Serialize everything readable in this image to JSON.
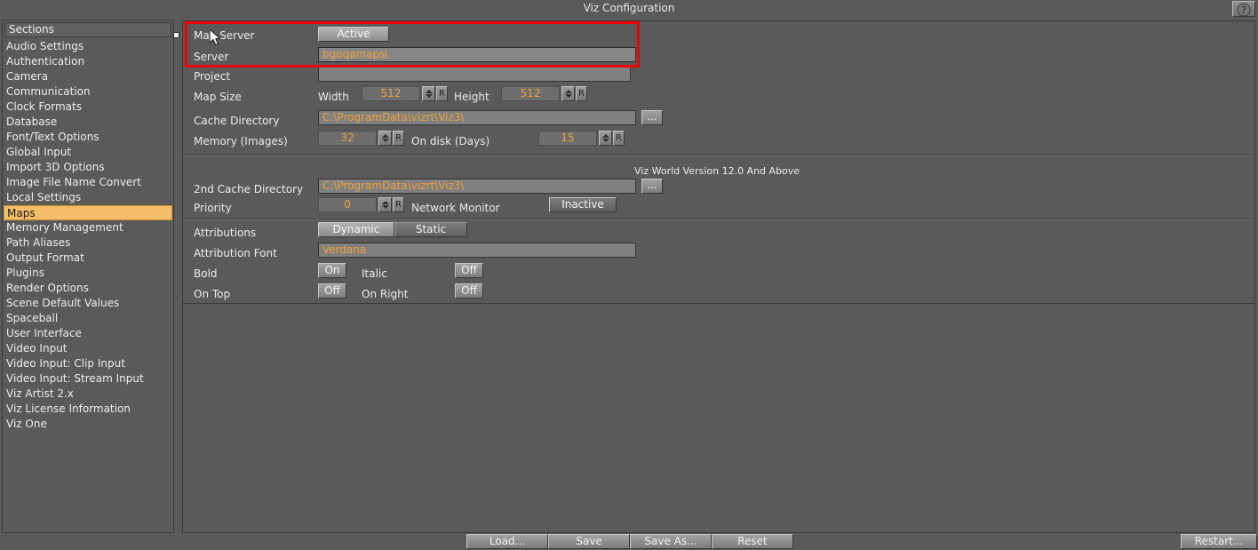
{
  "window": {
    "title": "Viz Configuration",
    "help_icon": "question-mark-icon"
  },
  "sidebar": {
    "header": "Sections",
    "selected": "Maps",
    "items": [
      {
        "label": "Audio Settings"
      },
      {
        "label": "Authentication"
      },
      {
        "label": "Camera"
      },
      {
        "label": "Communication"
      },
      {
        "label": "Clock Formats"
      },
      {
        "label": "Database"
      },
      {
        "label": "Font/Text Options"
      },
      {
        "label": "Global Input"
      },
      {
        "label": "Import 3D Options"
      },
      {
        "label": "Image File Name Convert"
      },
      {
        "label": "Local Settings"
      },
      {
        "label": "Maps"
      },
      {
        "label": "Memory Management"
      },
      {
        "label": "Path Aliases"
      },
      {
        "label": "Output Format"
      },
      {
        "label": "Plugins"
      },
      {
        "label": "Render Options"
      },
      {
        "label": "Scene Default Values"
      },
      {
        "label": "Spaceball"
      },
      {
        "label": "User Interface"
      },
      {
        "label": "Video Input"
      },
      {
        "label": "Video Input: Clip Input"
      },
      {
        "label": "Video Input: Stream Input"
      },
      {
        "label": "Viz Artist 2.x"
      },
      {
        "label": "Viz License Information"
      },
      {
        "label": "Viz One"
      }
    ]
  },
  "maps": {
    "map_server": {
      "label": "Map Server",
      "state": "Active"
    },
    "server": {
      "label": "Server",
      "value": "bgoqamaps"
    },
    "project": {
      "label": "Project",
      "value": ""
    },
    "map_size": {
      "label": "Map Size",
      "width_label": "Width",
      "width_value": "512",
      "width_reset": "R",
      "height_label": "Height",
      "height_value": "512",
      "height_reset": "R"
    },
    "cache_directory": {
      "label": "Cache Directory",
      "value": "C:\\ProgramData\\vizrt\\Viz3\\",
      "browse": "..."
    },
    "memory": {
      "label": "Memory (Images)",
      "value": "32",
      "reset": "R",
      "ondisk_label": "On disk (Days)",
      "ondisk_value": "15",
      "ondisk_reset": "R"
    },
    "vizworld": {
      "header": "Viz World Version 12.0 And Above",
      "second_cache_label": "2nd Cache Directory",
      "second_cache_value": "C:\\ProgramData\\vizrt\\Viz3\\",
      "second_cache_browse": "...",
      "priority_label": "Priority",
      "priority_value": "0",
      "priority_reset": "R",
      "network_monitor_label": "Network Monitor",
      "network_monitor_state": "Inactive"
    },
    "attributions": {
      "label": "Attributions",
      "dynamic": "Dynamic",
      "static": "Static",
      "font_label": "Attribution Font",
      "font_value": "Verdana",
      "bold_label": "Bold",
      "bold_state": "On",
      "italic_label": "Italic",
      "italic_state": "Off",
      "ontop_label": "On Top",
      "ontop_state": "Off",
      "onright_label": "On Right",
      "onright_state": "Off"
    }
  },
  "footer": {
    "load": "Load...",
    "save": "Save",
    "save_as": "Save As...",
    "reset": "Reset",
    "restart": "Restart..."
  },
  "colors": {
    "accent_value": "#f0a23c",
    "selection": "#f5be6b",
    "highlight_box": "#f20000",
    "panel_bg": "#5a5a5a"
  }
}
